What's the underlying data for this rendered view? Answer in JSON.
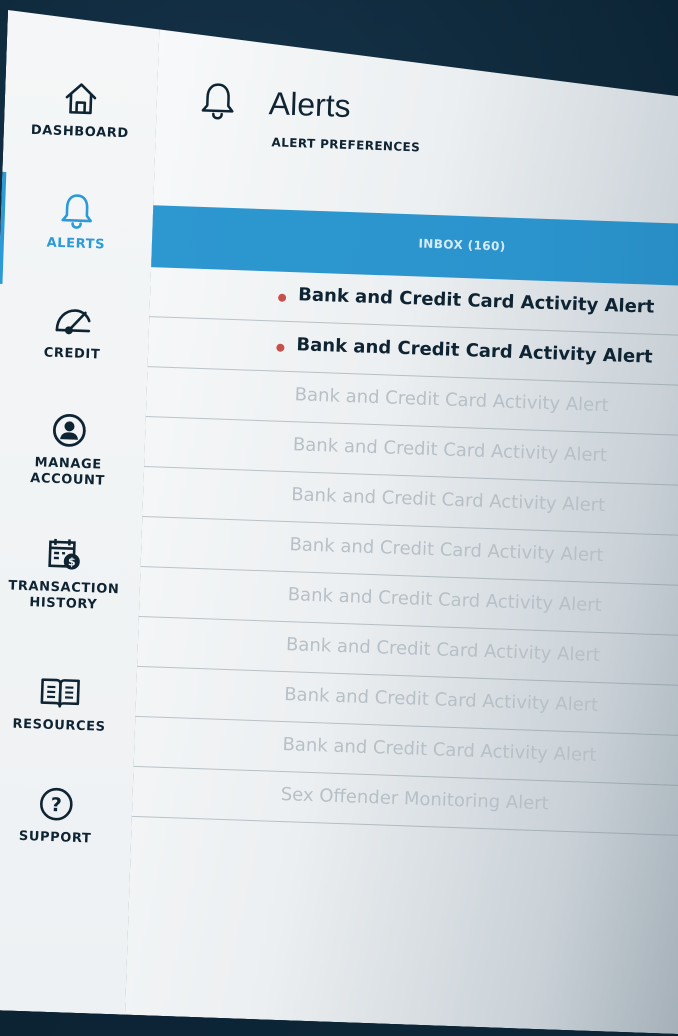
{
  "nav": {
    "items": [
      {
        "label": "DASHBOARD",
        "icon": "home-icon"
      },
      {
        "label": "ALERTS",
        "icon": "bell-icon"
      },
      {
        "label": "CREDIT",
        "icon": "gauge-icon"
      },
      {
        "label": "MANAGE ACCOUNT",
        "icon": "user-circle-icon"
      },
      {
        "label": "TRANSACTION HISTORY",
        "icon": "calendar-dollar-icon"
      },
      {
        "label": "RESOURCES",
        "icon": "book-icon"
      },
      {
        "label": "SUPPORT",
        "icon": "help-icon"
      }
    ],
    "active_index": 1
  },
  "header": {
    "icon": "bell-icon",
    "title": "Alerts",
    "preferences_link": "ALERT PREFERENCES"
  },
  "inbox": {
    "label": "INBOX (160)"
  },
  "alerts": [
    {
      "text": "Bank and Credit Card Activity Alert",
      "unread": true
    },
    {
      "text": "Bank and Credit Card Activity Alert",
      "unread": true
    },
    {
      "text": "Bank and Credit Card Activity Alert",
      "unread": false
    },
    {
      "text": "Bank and Credit Card Activity Alert",
      "unread": false
    },
    {
      "text": "Bank and Credit Card Activity Alert",
      "unread": false
    },
    {
      "text": "Bank and Credit Card Activity Alert",
      "unread": false
    },
    {
      "text": "Bank and Credit Card Activity Alert",
      "unread": false
    },
    {
      "text": "Bank and Credit Card Activity Alert",
      "unread": false
    },
    {
      "text": "Bank and Credit Card Activity Alert",
      "unread": false
    },
    {
      "text": "Bank and Credit Card Activity Alert",
      "unread": false
    },
    {
      "text": "Sex Offender Monitoring Alert",
      "unread": false
    }
  ],
  "colors": {
    "accent": "#2b9ad6",
    "navy": "#0f2433",
    "unread_dot": "#c8504c",
    "backdrop": "#0d2637"
  }
}
